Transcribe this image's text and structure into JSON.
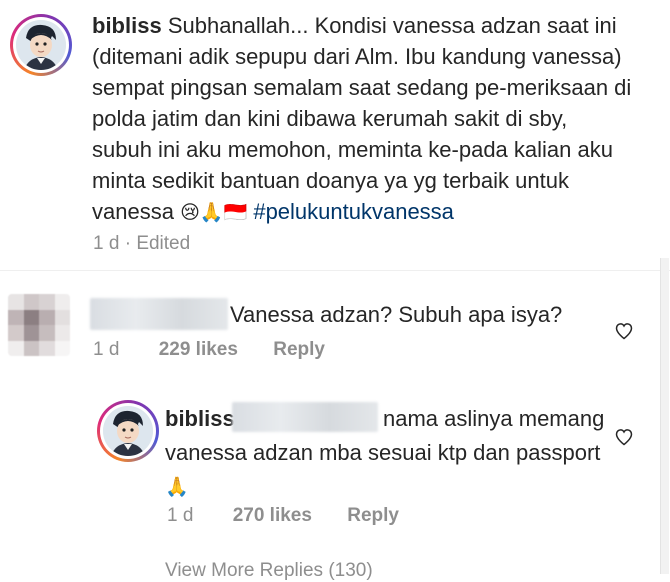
{
  "post": {
    "username": "bibliss",
    "caption_text": "Subhanallah... Kondisi vanessa adzan saat ini (ditemani adik sepupu dari Alm. Ibu kandung vanessa) sempat pingsan semalam saat sedang pe-meriksaan di polda jatim dan kini dibawa kerumah sakit di sby, subuh ini aku memohon, meminta ke-pada kalian aku minta sedikit bantuan doanya ya yg terbaik untuk vanessa",
    "emojis": "😢🙏🇮🇩",
    "hashtag": "#pelukuntukvanessa",
    "time": "1 d",
    "edited": "Edited"
  },
  "comments": [
    {
      "text": "Vanessa adzan? Subuh apa isya?",
      "time": "1 d",
      "likes": "229 likes",
      "reply_label": "Reply"
    }
  ],
  "reply": {
    "username": "bibliss",
    "text": "nama aslinya memang vanessa adzan mba sesuai ktp dan passport",
    "emoji": "🙏",
    "time": "1 d",
    "likes": "270 likes",
    "reply_label": "Reply"
  },
  "view_more": "View More Replies (130)",
  "icons": {
    "heart": "heart-outline-icon"
  },
  "colors": {
    "text": "#262626",
    "muted": "#8e8e8e",
    "hashtag": "#003569"
  }
}
